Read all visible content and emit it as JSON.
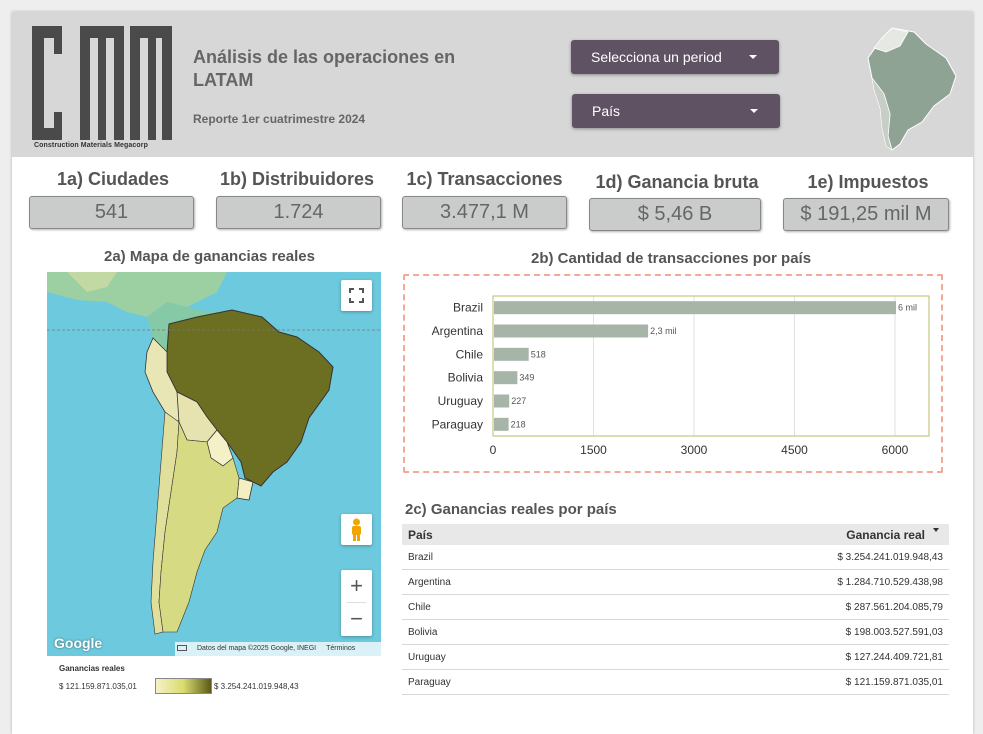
{
  "header": {
    "logo_letters": [
      "c",
      "m",
      "m"
    ],
    "logo_subtitle": "Construction Materials Megacorp",
    "title": "Análisis de las operaciones en LATAM",
    "subtitle": "Reporte 1er cuatrimestre 2024",
    "period_dropdown": "Selecciona un period",
    "country_dropdown": "País"
  },
  "kpis": [
    {
      "label": "1a) Ciudades",
      "value": "541"
    },
    {
      "label": "1b) Distribuidores",
      "value": "1.724"
    },
    {
      "label": "1c) Transacciones",
      "value": "3.477,1 M"
    },
    {
      "label": "1d) Ganancia bruta",
      "value": "$ 5,46 B"
    },
    {
      "label": "1e) Impuestos",
      "value": "$ 191,25 mil M"
    }
  ],
  "map_section": {
    "title": "2a) Mapa de ganancias reales",
    "google_label": "Google",
    "attribution": "Datos del mapa ©2025 Google, INEGI",
    "terms": "Términos",
    "legend_title": "Ganancias reales",
    "legend_min": "$ 121.159.871.035,01",
    "legend_max": "$ 3.254.241.019.948,43",
    "fullscreen_icon": "fullscreen-icon",
    "pegman_icon": "pegman-icon",
    "colors": {
      "water": "#6dc9dd",
      "high": "#6b6b1f",
      "low": "#f3efc4"
    }
  },
  "bar_section": {
    "title": "2b) Cantidad de transacciones por país"
  },
  "chart_data": {
    "type": "bar",
    "orientation": "horizontal",
    "categories": [
      "Brazil",
      "Argentina",
      "Chile",
      "Bolivia",
      "Uruguay",
      "Paraguay"
    ],
    "values": [
      6000,
      2300,
      518,
      349,
      227,
      218
    ],
    "data_labels": [
      "6 mil",
      "2,3 mil",
      "518",
      "349",
      "227",
      "218"
    ],
    "xticks": [
      "0",
      "1500",
      "3000",
      "4500",
      "6000"
    ],
    "xlim": [
      0,
      6000
    ],
    "bar_color": "#a7b5a9",
    "grid": true
  },
  "table_section": {
    "title": "2c) Ganancias reales por país",
    "col_country": "País",
    "col_value": "Ganancia real",
    "rows": [
      {
        "country": "Brazil",
        "value": "$ 3.254.241.019.948,43"
      },
      {
        "country": "Argentina",
        "value": "$ 1.284.710.529.438,98"
      },
      {
        "country": "Chile",
        "value": "$ 287.561.204.085,79"
      },
      {
        "country": "Bolivia",
        "value": "$ 198.003.527.591,03"
      },
      {
        "country": "Uruguay",
        "value": "$ 127.244.409.721,81"
      },
      {
        "country": "Paraguay",
        "value": "$ 121.159.871.035,01"
      }
    ]
  }
}
